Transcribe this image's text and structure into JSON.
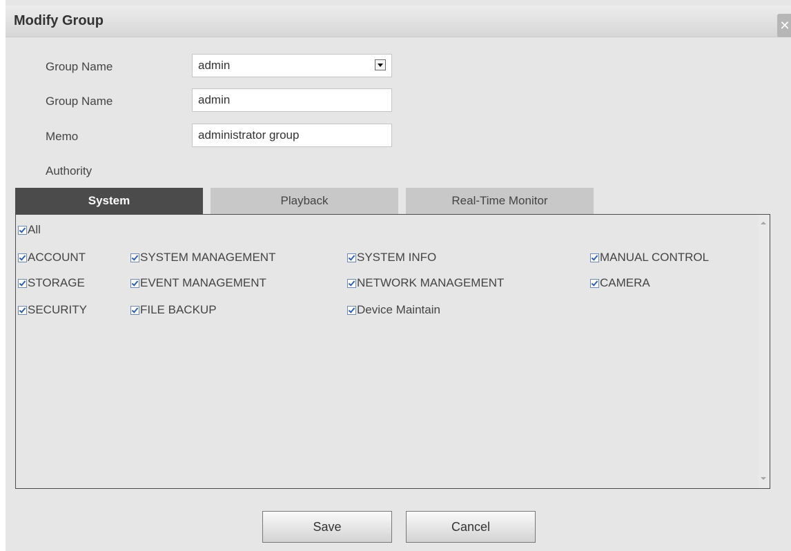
{
  "dialog": {
    "title": "Modify Group",
    "close_icon_glyph": "✕"
  },
  "form": {
    "group_select": {
      "label": "Group Name",
      "value": "admin"
    },
    "group_name": {
      "label": "Group Name",
      "value": "admin"
    },
    "memo": {
      "label": "Memo",
      "value": "administrator group"
    },
    "authority_label": "Authority"
  },
  "tabs": [
    {
      "label": "System",
      "active": true
    },
    {
      "label": "Playback",
      "active": false
    },
    {
      "label": "Real-Time Monitor",
      "active": false
    }
  ],
  "permissions": {
    "all": {
      "label": "All",
      "checked": true
    },
    "items": [
      {
        "label": "ACCOUNT",
        "checked": true
      },
      {
        "label": "SYSTEM MANAGEMENT",
        "checked": true
      },
      {
        "label": "SYSTEM INFO",
        "checked": true
      },
      {
        "label": "MANUAL CONTROL",
        "checked": true
      },
      {
        "label": "STORAGE",
        "checked": true
      },
      {
        "label": "EVENT MANAGEMENT",
        "checked": true
      },
      {
        "label": "NETWORK MANAGEMENT",
        "checked": true
      },
      {
        "label": "CAMERA",
        "checked": true
      },
      {
        "label": "SECURITY",
        "checked": true
      },
      {
        "label": "FILE BACKUP",
        "checked": true
      },
      {
        "label": "Device Maintain",
        "checked": true
      }
    ]
  },
  "buttons": {
    "save": "Save",
    "cancel": "Cancel"
  }
}
